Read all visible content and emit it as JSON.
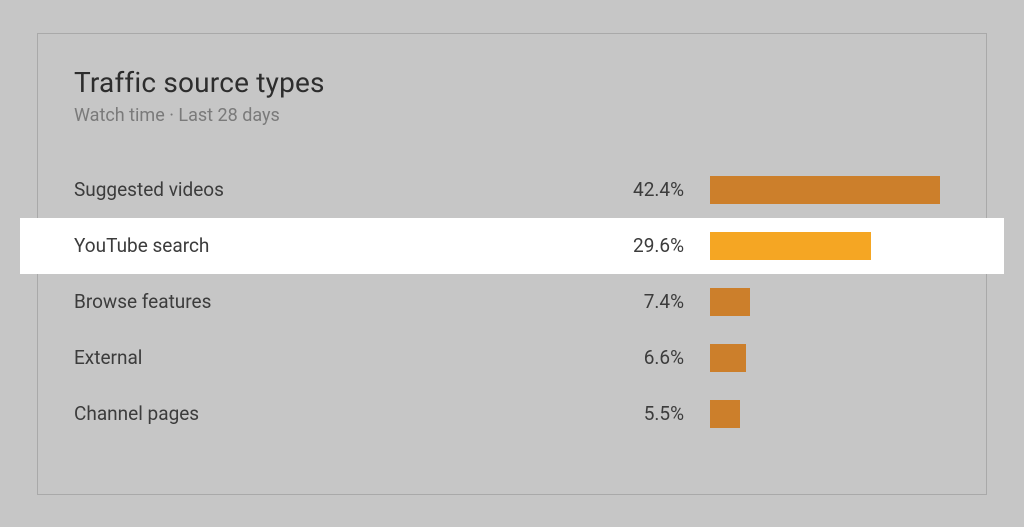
{
  "header": {
    "title": "Traffic source types",
    "subtitle": "Watch time · Last 28 days"
  },
  "rows": [
    {
      "label": "Suggested videos",
      "value": "42.4%",
      "highlight": false,
      "bar_color": "dark"
    },
    {
      "label": "YouTube search",
      "value": "29.6%",
      "highlight": true,
      "bar_color": "light"
    },
    {
      "label": "Browse features",
      "value": "7.4%",
      "highlight": false,
      "bar_color": "dark"
    },
    {
      "label": "External",
      "value": "6.6%",
      "highlight": false,
      "bar_color": "dark"
    },
    {
      "label": "Channel pages",
      "value": "5.5%",
      "highlight": false,
      "bar_color": "dark"
    }
  ],
  "chart_data": {
    "type": "bar",
    "title": "Traffic source types",
    "subtitle": "Watch time · Last 28 days",
    "xlabel": "",
    "ylabel": "",
    "categories": [
      "Suggested videos",
      "YouTube search",
      "Browse features",
      "External",
      "Channel pages"
    ],
    "values": [
      42.4,
      29.6,
      7.4,
      6.6,
      5.5
    ],
    "unit": "percent",
    "xlim": [
      0,
      45
    ],
    "highlight_index": 1,
    "colors": {
      "default": "#cc7f2b",
      "highlight": "#f5a623"
    }
  }
}
